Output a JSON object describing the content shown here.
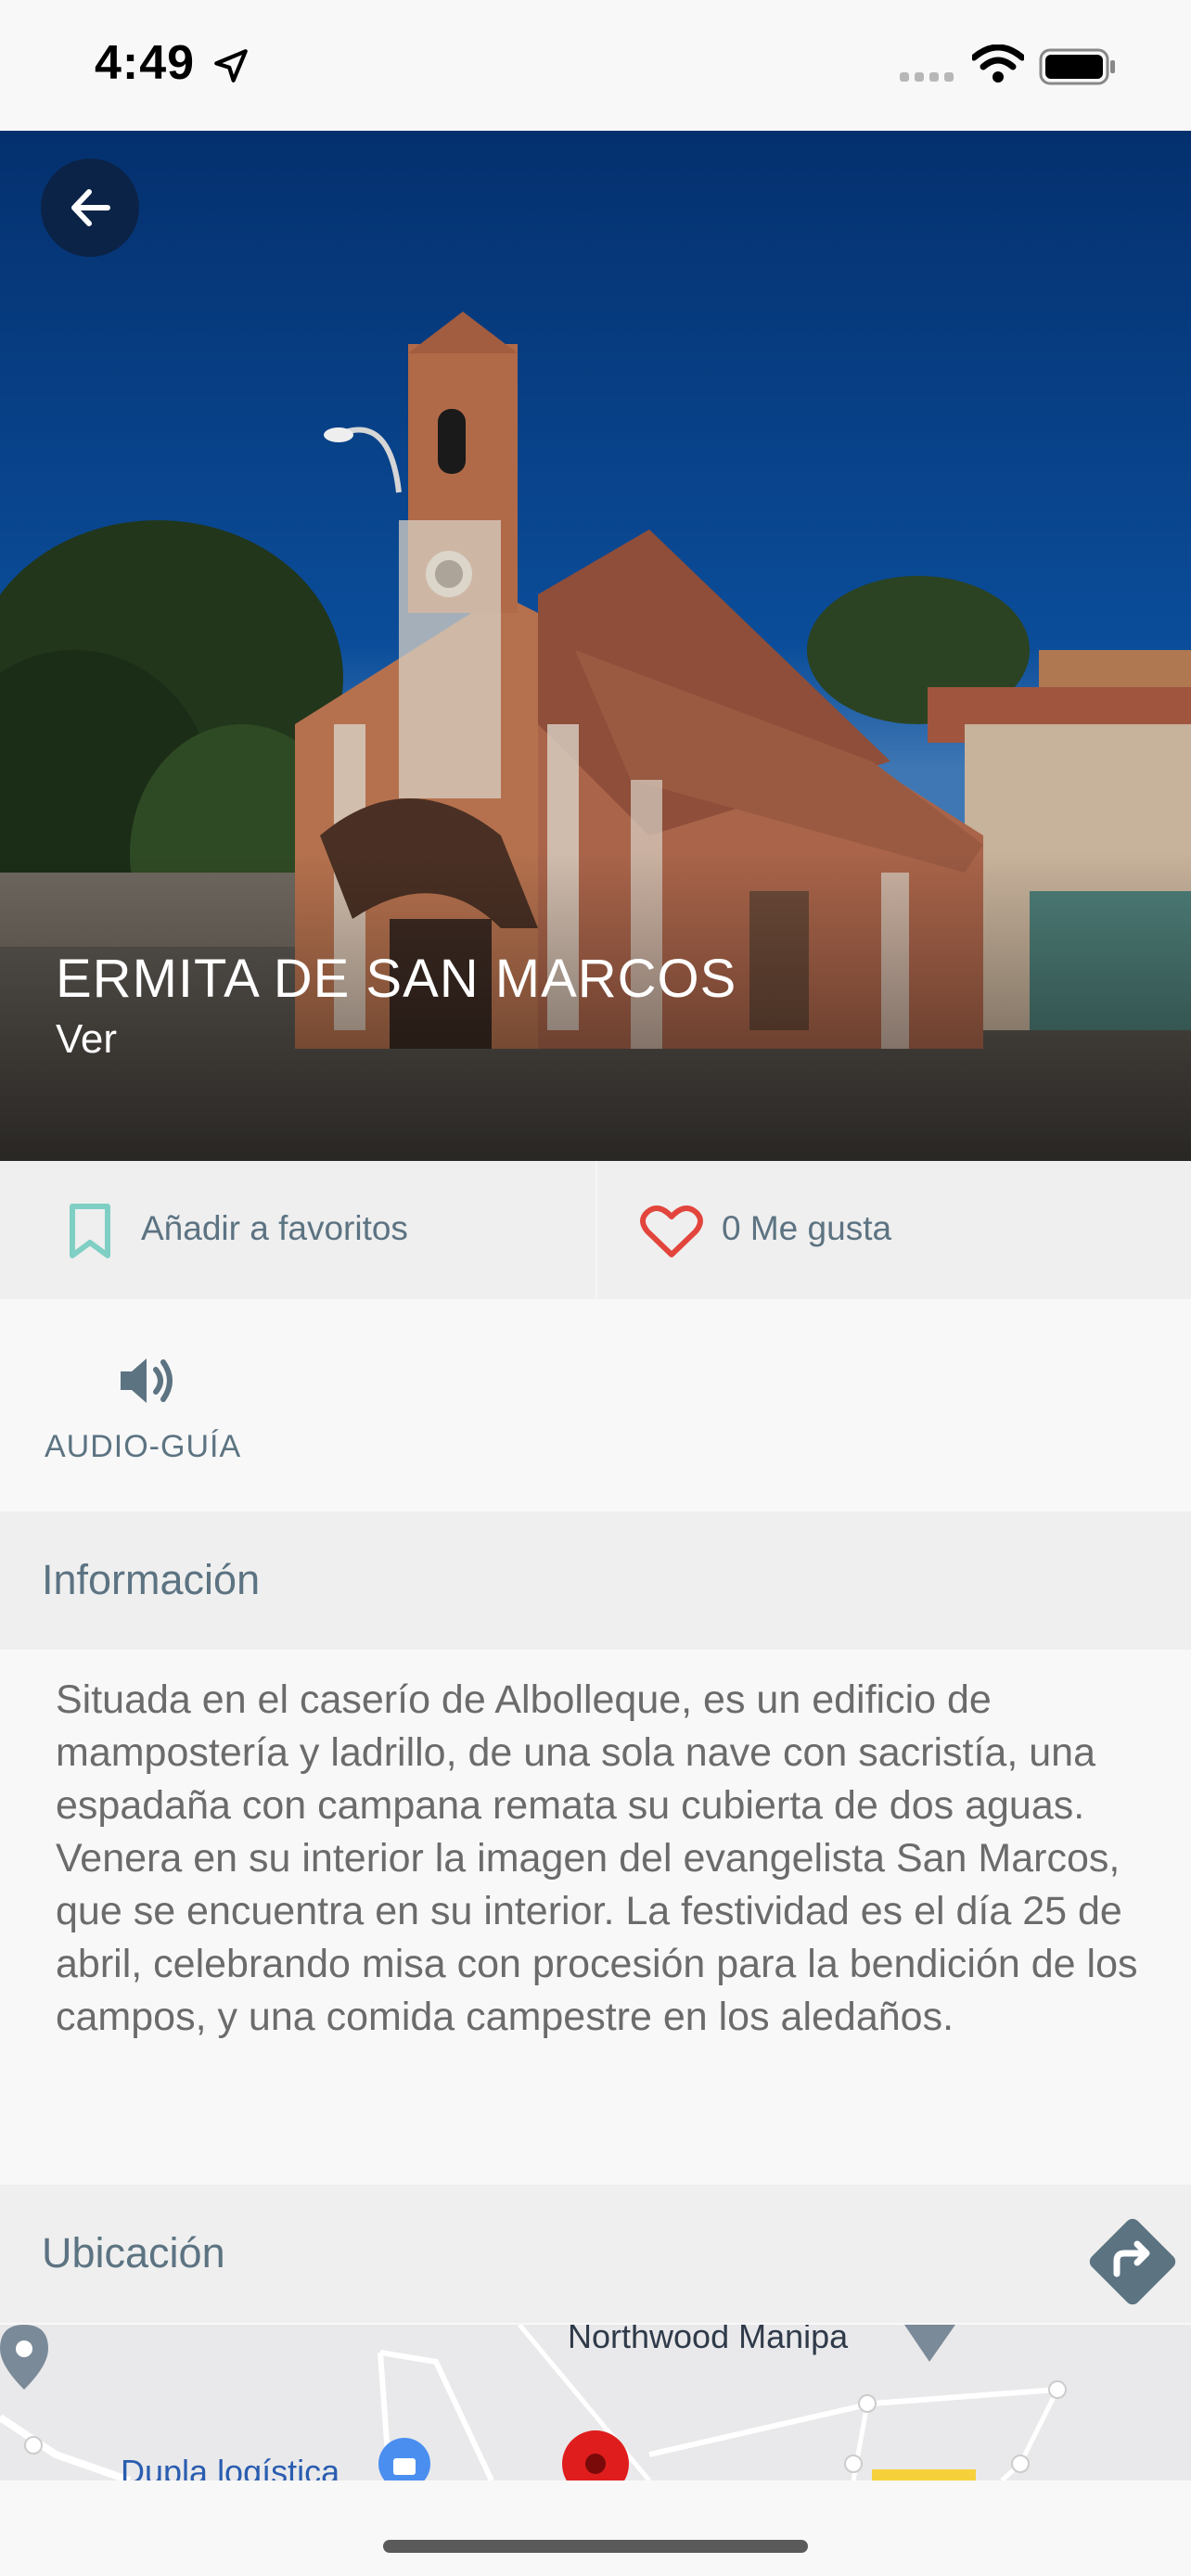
{
  "status_bar": {
    "time": "4:49"
  },
  "place": {
    "title": "ERMITA DE SAN MARCOS",
    "subtitle": "Ver"
  },
  "actions": {
    "favorites_label": "Añadir a favoritos",
    "likes_label": "0 Me gusta"
  },
  "audio_guide": {
    "label": "AUDIO-GUÍA"
  },
  "information": {
    "title": "Información",
    "text": "Situada en el caserío de Albolleque, es un edificio de mampostería y ladrillo, de una sola nave con sacristía, una espadaña con campana remata su cubierta de dos aguas. Venera en su interior la imagen del evangelista San Marcos, que se encuentra en su interior. La festividad es el día 25 de abril, celebrando misa con procesión para la bendición de los campos, y una comida campestre en los aledaños."
  },
  "location": {
    "title": "Ubicación"
  },
  "map": {
    "label_1": "Northwood Manipa",
    "label_2": "Dupla logística"
  },
  "colors": {
    "accent_teal": "#7fcfc4",
    "heart_red": "#e2453c",
    "label_slate": "#5c7382"
  }
}
